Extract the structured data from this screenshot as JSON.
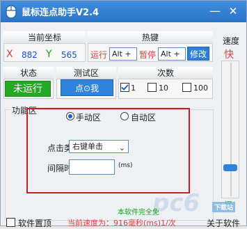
{
  "window": {
    "title": "鼠标连点助手V2.4",
    "minimize_glyph": "—",
    "close_glyph": "✕"
  },
  "coords": {
    "heading": "当前坐标",
    "x_label": "X",
    "x_value": "882",
    "y_label": "Y",
    "y_value": "565"
  },
  "hotkeys": {
    "heading": "热键",
    "run_label": "运行",
    "run_value": "Alt +",
    "pause_label": "暂停",
    "pause_value": "Alt +",
    "edit_label": "修改"
  },
  "speed": {
    "heading": "速度",
    "fast_label": "快",
    "slow_label": "慢",
    "level": 0.2
  },
  "status": {
    "heading": "状态",
    "value": "未运行"
  },
  "test_area": {
    "heading": "测试区",
    "button_label": "点⊙我"
  },
  "count": {
    "heading": "次数",
    "options": [
      {
        "label": "1",
        "checked": true
      },
      {
        "label": "10",
        "checked": false
      },
      {
        "label": "100",
        "checked": false
      }
    ]
  },
  "function": {
    "group_title": "功能区",
    "modes": [
      {
        "label": "手动区",
        "selected": true
      },
      {
        "label": "自动区",
        "selected": false
      }
    ],
    "click_type_label": "点击类型：",
    "click_type_value": "右键单击",
    "interval_label": "间隔时间：",
    "interval_value": "",
    "interval_unit": "(ms)"
  },
  "footer": {
    "pin_label": "软件置顶",
    "pin_checked": false,
    "current_speed": "当前速度为：916毫秒(ms)1/次",
    "notice": "本软件完全免",
    "about": "关于软件"
  },
  "watermark": {
    "logo_text": "pc6",
    "sub_text": "下载站"
  },
  "colors": {
    "titlebar": "#2a74c8",
    "status_green": "#23a923",
    "accent_blue": "#2f83dc",
    "highlight_red": "#c81e1e"
  }
}
